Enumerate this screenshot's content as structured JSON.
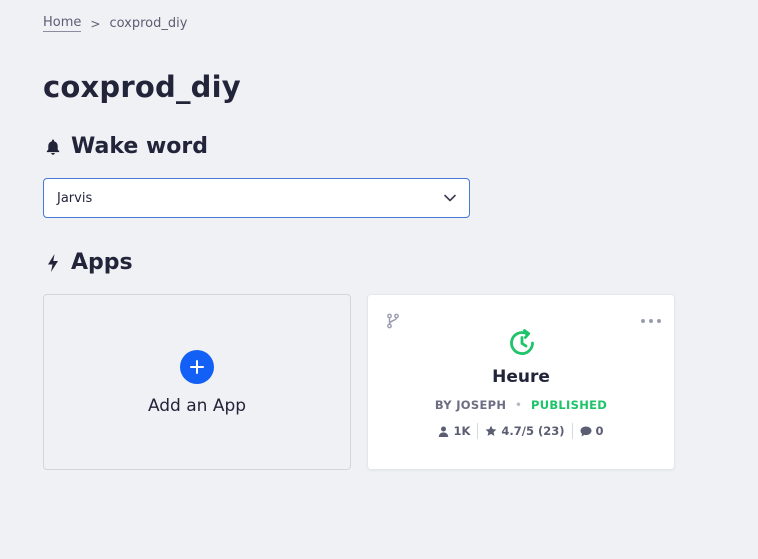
{
  "breadcrumb": {
    "home": "Home",
    "separator": ">",
    "current": "coxprod_diy"
  },
  "page": {
    "title": "coxprod_diy"
  },
  "wake_word": {
    "heading": "Wake word",
    "icon": "bell-icon",
    "selected": "Jarvis"
  },
  "apps": {
    "heading": "Apps",
    "icon": "bolt-icon",
    "add_label": "Add an App",
    "items": [
      {
        "name": "Heure",
        "author": "BY JOSEPH",
        "status": "PUBLISHED",
        "users": "1K",
        "rating": "4.7/5 (23)",
        "comments": "0",
        "icon": "clock-refresh-icon"
      }
    ]
  },
  "colors": {
    "background": "#f0f1f5",
    "accent": "#1260f5",
    "published": "#1ec46a",
    "select_border": "#4a78d8"
  }
}
